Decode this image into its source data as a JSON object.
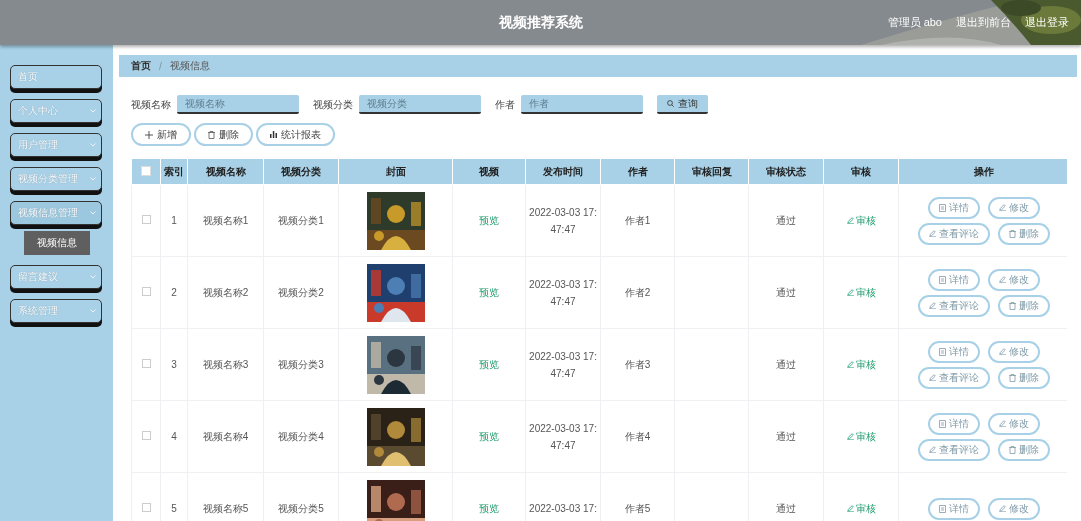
{
  "header": {
    "title": "视频推荐系统",
    "user": "管理员 abo",
    "links": [
      "退出到前台",
      "退出登录"
    ]
  },
  "sidebar": {
    "items": [
      {
        "label": "首页",
        "has_children": false,
        "expanded": false
      },
      {
        "label": "个人中心",
        "has_children": true,
        "expanded": false
      },
      {
        "label": "用户管理",
        "has_children": true,
        "expanded": false
      },
      {
        "label": "视频分类管理",
        "has_children": true,
        "expanded": false
      },
      {
        "label": "视频信息管理",
        "has_children": true,
        "expanded": true,
        "children": [
          {
            "label": "视频信息",
            "selected": true
          }
        ]
      },
      {
        "label": "留言建议",
        "has_children": true,
        "expanded": false
      },
      {
        "label": "系统管理",
        "has_children": true,
        "expanded": false
      }
    ]
  },
  "breadcrumb": [
    "首页",
    "视频信息"
  ],
  "breadcrumb_separator": "/",
  "search": {
    "fields": [
      {
        "label": "视频名称",
        "placeholder": "视频名称"
      },
      {
        "label": "视频分类",
        "placeholder": "视频分类"
      },
      {
        "label": "作者",
        "placeholder": "作者"
      }
    ],
    "button": "查询"
  },
  "actions": [
    {
      "label": "新增",
      "kind": "add"
    },
    {
      "label": "删除",
      "kind": "delete"
    },
    {
      "label": "统计报表",
      "kind": "chart"
    }
  ],
  "table": {
    "select_all": {
      "checked": false
    },
    "columns": [
      "",
      "索引",
      "视频名称",
      "视频分类",
      "封面",
      "视频",
      "发布时间",
      "作者",
      "审核回复",
      "审核状态",
      "审核",
      "操作"
    ],
    "rows": [
      {
        "checked": false,
        "index": "1",
        "name": "视频名称1",
        "category": "视频分类1",
        "cover": {
          "kind": "picture"
        },
        "video": "预览",
        "date": [
          "2022-03-03 17:",
          "47:47"
        ],
        "author": "作者1",
        "status": "通过",
        "audit": "审核",
        "ops": [
          {
            "label": "详情",
            "kind": "detail"
          },
          {
            "label": "修改",
            "kind": "edit"
          },
          {
            "label": "查看评论",
            "kind": "edit"
          },
          {
            "label": "删除",
            "kind": "delete"
          }
        ]
      },
      {
        "checked": false,
        "index": "2",
        "name": "视频名称2",
        "category": "视频分类2",
        "cover": {
          "kind": "picture"
        },
        "video": "预览",
        "date": [
          "2022-03-03 17:",
          "47:47"
        ],
        "author": "作者2",
        "status": "通过",
        "audit": "审核",
        "ops": [
          {
            "label": "详情",
            "kind": "detail"
          },
          {
            "label": "修改",
            "kind": "edit"
          },
          {
            "label": "查看评论",
            "kind": "edit"
          },
          {
            "label": "删除",
            "kind": "delete"
          }
        ]
      },
      {
        "checked": false,
        "index": "3",
        "name": "视频名称3",
        "category": "视频分类3",
        "cover": {
          "kind": "picture"
        },
        "video": "预览",
        "date": [
          "2022-03-03 17:",
          "47:47"
        ],
        "author": "作者3",
        "status": "通过",
        "audit": "审核",
        "ops": [
          {
            "label": "详情",
            "kind": "detail"
          },
          {
            "label": "修改",
            "kind": "edit"
          },
          {
            "label": "查看评论",
            "kind": "edit"
          },
          {
            "label": "删除",
            "kind": "delete"
          }
        ]
      },
      {
        "checked": false,
        "index": "4",
        "name": "视频名称4",
        "category": "视频分类4",
        "cover": {
          "kind": "picture"
        },
        "video": "预览",
        "date": [
          "2022-03-03 17:",
          "47:47"
        ],
        "author": "作者4",
        "status": "通过",
        "audit": "审核",
        "ops": [
          {
            "label": "详情",
            "kind": "detail"
          },
          {
            "label": "修改",
            "kind": "edit"
          },
          {
            "label": "查看评论",
            "kind": "edit"
          },
          {
            "label": "删除",
            "kind": "delete"
          }
        ]
      },
      {
        "checked": false,
        "index": "5",
        "name": "视频名称5",
        "category": "视频分类5",
        "cover": {
          "kind": "picture"
        },
        "video": "预览",
        "date": [
          "2022-03-03 17:"
        ],
        "author": "作者5",
        "status": "通过",
        "audit": "审核",
        "ops": [
          {
            "label": "详情",
            "kind": "detail"
          },
          {
            "label": "修改",
            "kind": "edit"
          }
        ]
      }
    ]
  }
}
